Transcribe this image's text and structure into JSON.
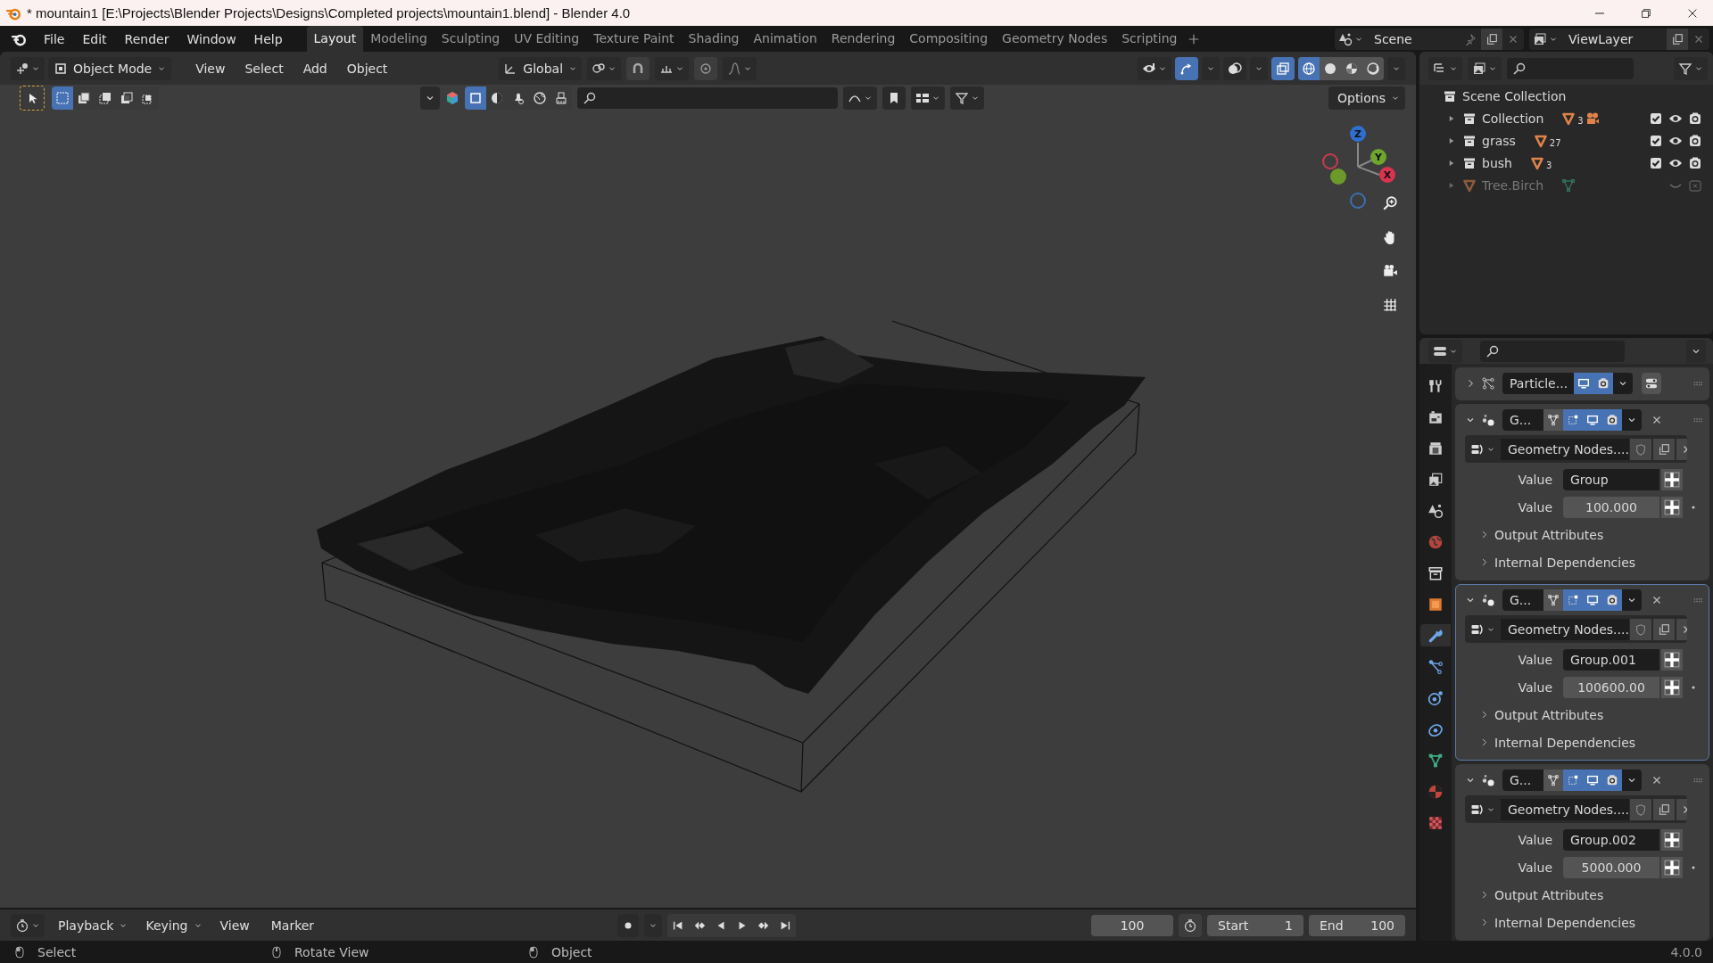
{
  "window": {
    "title": "* mountain1 [E:\\Projects\\Blender Projects\\Designs\\Completed projects\\mountain1.blend] - Blender 4.0"
  },
  "menu": [
    "File",
    "Edit",
    "Render",
    "Window",
    "Help"
  ],
  "workspaces": [
    {
      "label": "Layout",
      "selected": true
    },
    {
      "label": "Modeling",
      "selected": false
    },
    {
      "label": "Sculpting",
      "selected": false
    },
    {
      "label": "UV Editing",
      "selected": false
    },
    {
      "label": "Texture Paint",
      "selected": false
    },
    {
      "label": "Shading",
      "selected": false
    },
    {
      "label": "Animation",
      "selected": false
    },
    {
      "label": "Rendering",
      "selected": false
    },
    {
      "label": "Compositing",
      "selected": false
    },
    {
      "label": "Geometry Nodes",
      "selected": false
    },
    {
      "label": "Scripting",
      "selected": false
    }
  ],
  "scene": {
    "name": "Scene"
  },
  "view_layer": {
    "name": "ViewLayer"
  },
  "viewport_header": {
    "mode": "Object Mode",
    "menus": [
      "View",
      "Select",
      "Add",
      "Object"
    ],
    "orientation": "Global",
    "gizmos_on": true,
    "xray_on": true,
    "shading": [
      {
        "kind": "wireframe",
        "selected": true
      },
      {
        "kind": "solid",
        "selected": false
      },
      {
        "kind": "material",
        "selected": false
      },
      {
        "kind": "rendered",
        "selected": false
      }
    ]
  },
  "tool_header": {
    "select_modes": [
      {
        "kind": "set",
        "selected": true
      },
      {
        "kind": "extend",
        "selected": false
      },
      {
        "kind": "subtract",
        "selected": false
      },
      {
        "kind": "invert",
        "selected": false
      },
      {
        "kind": "intersect",
        "selected": false
      }
    ],
    "filters": [
      {
        "kind": "mesh",
        "selected": true
      },
      {
        "kind": "material",
        "selected": false
      },
      {
        "kind": "light",
        "selected": false
      },
      {
        "kind": "world",
        "selected": false
      },
      {
        "kind": "brush",
        "selected": false
      }
    ],
    "options": "Options"
  },
  "gizmo": {
    "axes": [
      "Z",
      "Y",
      "X"
    ]
  },
  "outliner": {
    "root": "Scene Collection",
    "items": [
      {
        "kind": "collection",
        "name": "Collection",
        "count": "3",
        "checked": true,
        "disabled": false
      },
      {
        "kind": "collection",
        "name": "grass",
        "count": "27",
        "checked": true,
        "disabled": false
      },
      {
        "kind": "collection",
        "name": "bush",
        "count": "3",
        "checked": true,
        "disabled": false
      },
      {
        "kind": "object",
        "name": "Tree.Birch",
        "disabled": true
      }
    ]
  },
  "properties_tabs": [
    {
      "kind": "tool",
      "selected": false
    },
    {
      "kind": "render",
      "selected": false
    },
    {
      "kind": "output",
      "selected": false
    },
    {
      "kind": "view_layer",
      "selected": false
    },
    {
      "kind": "scene",
      "selected": false
    },
    {
      "kind": "world",
      "selected": false
    },
    {
      "kind": "collection",
      "selected": false
    },
    {
      "kind": "object",
      "selected": false
    },
    {
      "kind": "modifiers",
      "selected": true
    },
    {
      "kind": "particles",
      "selected": false
    },
    {
      "kind": "physics",
      "selected": false
    },
    {
      "kind": "constraints",
      "selected": false
    },
    {
      "kind": "data",
      "selected": false
    },
    {
      "kind": "material",
      "selected": false
    },
    {
      "kind": "texture",
      "selected": false
    }
  ],
  "modifiers": [
    {
      "kind": "particles",
      "name": "Particle...",
      "expanded": false,
      "active": false
    },
    {
      "kind": "geometry_nodes",
      "name": "G...",
      "expanded": true,
      "active": false,
      "node_group": "Geometry Nodes....",
      "inputs": [
        {
          "kind": "text",
          "label": "Value",
          "value": "Group"
        },
        {
          "kind": "number",
          "label": "Value",
          "value": "100.000"
        }
      ],
      "panels": [
        "Output Attributes",
        "Internal Dependencies"
      ]
    },
    {
      "kind": "geometry_nodes",
      "name": "G...",
      "expanded": true,
      "active": true,
      "node_group": "Geometry Nodes....",
      "inputs": [
        {
          "kind": "text",
          "label": "Value",
          "value": "Group.001"
        },
        {
          "kind": "number",
          "label": "Value",
          "value": "100600.00"
        }
      ],
      "panels": [
        "Output Attributes",
        "Internal Dependencies"
      ]
    },
    {
      "kind": "geometry_nodes",
      "name": "G...",
      "expanded": true,
      "active": false,
      "node_group": "Geometry Nodes....",
      "inputs": [
        {
          "kind": "text",
          "label": "Value",
          "value": "Group.002"
        },
        {
          "kind": "number",
          "label": "Value",
          "value": "5000.000"
        }
      ],
      "panels": [
        "Output Attributes",
        "Internal Dependencies"
      ]
    }
  ],
  "timeline": {
    "menus": [
      "Playback",
      "Keying",
      "View",
      "Marker"
    ],
    "current_frame": "100",
    "start_label": "Start",
    "start": "1",
    "end_label": "End",
    "end": "100"
  },
  "status_bar": {
    "hints": [
      "Select",
      "Rotate View",
      "Object"
    ],
    "version": "4.0.0"
  }
}
